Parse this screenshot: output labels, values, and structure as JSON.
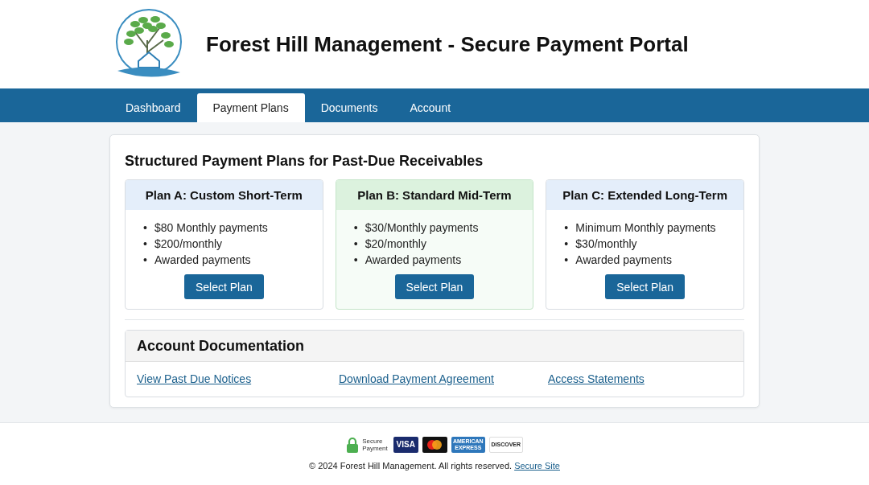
{
  "header": {
    "title": "Forest Hill Management - Secure Payment Portal"
  },
  "nav": [
    {
      "label": "Dashboard",
      "selected": false
    },
    {
      "label": "Payment Plans",
      "selected": true
    },
    {
      "label": "Documents",
      "selected": false
    },
    {
      "label": "Account",
      "selected": false
    }
  ],
  "plans_section": {
    "title": "Structured Payment Plans for Past-Due Receivables",
    "marker": "•",
    "plans": [
      {
        "title": "Plan A: Custom Short-Term",
        "highlighted": false,
        "features": [
          "$80 Monthly payments",
          "$200/monthly",
          "Awarded payments"
        ],
        "button": "Select Plan"
      },
      {
        "title": "Plan B: Standard Mid-Term",
        "highlighted": true,
        "features": [
          "$30/Monthly payments",
          "$20/monthly",
          "Awarded payments"
        ],
        "button": "Select Plan"
      },
      {
        "title": "Plan C: Extended Long-Term",
        "highlighted": false,
        "features": [
          "Minimum Monthly payments",
          "$30/monthly",
          "Awarded payments"
        ],
        "button": "Select Plan"
      }
    ]
  },
  "documentation": {
    "title": "Account Documentation",
    "links": [
      "View Past Due Notices",
      "Download Payment Agreement",
      "Access Statements"
    ]
  },
  "footer": {
    "secure_badge": [
      "Secure",
      "Payment"
    ],
    "cards": [
      {
        "kind": "visa",
        "label": "VISA"
      },
      {
        "kind": "mastercard"
      },
      {
        "kind": "amex",
        "label": "AMERICAN EXPRESS"
      },
      {
        "kind": "discover",
        "label": "DISCOVER"
      }
    ],
    "copyright": "© 2024 Forest Hill Management. All rights reserved.",
    "link": "Secure Site"
  }
}
